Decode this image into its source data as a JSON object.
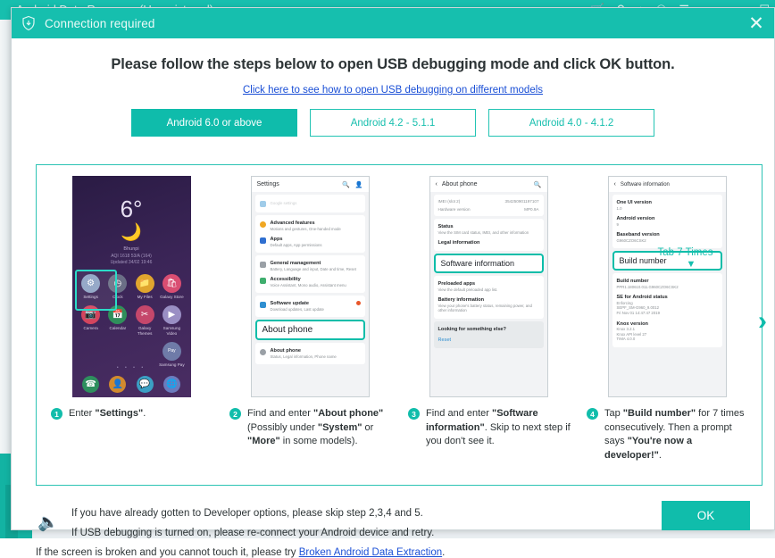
{
  "background_window": {
    "title": "Android Data Recovery (Unregistered)",
    "toolbar_icons": [
      "cart-icon",
      "key-icon",
      "download-icon",
      "chat-icon",
      "menu-icon"
    ],
    "window_controls": [
      "minimize-icon",
      "maximize-icon"
    ]
  },
  "dialog": {
    "title": "Connection required",
    "title_icon": "shield-download-icon",
    "close_label": "✕",
    "headline": "Please follow the steps below to open USB debugging mode and click OK button.",
    "sub_link": "Click here to see how to open USB debugging on different models",
    "next_arrow": "›",
    "tabs": [
      {
        "label": "Android 6.0 or above",
        "active": true
      },
      {
        "label": "Android 4.2 - 5.1.1",
        "active": false
      },
      {
        "label": "Android 4.0 - 4.1.2",
        "active": false
      }
    ]
  },
  "steps": [
    {
      "number": "1",
      "caption_parts": [
        {
          "text": "Enter ",
          "bold": false
        },
        {
          "text": "\"Settings\"",
          "bold": true
        },
        {
          "text": ".",
          "bold": false
        }
      ]
    },
    {
      "number": "2",
      "caption_parts": [
        {
          "text": "Find and enter ",
          "bold": false
        },
        {
          "text": "\"About phone\"",
          "bold": true
        },
        {
          "text": " (Possibly under ",
          "bold": false
        },
        {
          "text": "\"System\"",
          "bold": true
        },
        {
          "text": " or ",
          "bold": false
        },
        {
          "text": "\"More\"",
          "bold": true
        },
        {
          "text": " in some models).",
          "bold": false
        }
      ]
    },
    {
      "number": "3",
      "caption_parts": [
        {
          "text": "Find and enter ",
          "bold": false
        },
        {
          "text": "\"Software information\"",
          "bold": true
        },
        {
          "text": ". Skip to next step if you don't see it.",
          "bold": false
        }
      ]
    },
    {
      "number": "4",
      "caption_parts": [
        {
          "text": "Tap ",
          "bold": false
        },
        {
          "text": "\"Build number\"",
          "bold": true
        },
        {
          "text": " for 7 times consecutively. Then a prompt says ",
          "bold": false
        },
        {
          "text": "\"You're now a developer!\"",
          "bold": true
        },
        {
          "text": ".",
          "bold": false
        }
      ]
    }
  ],
  "phone_home": {
    "temperature": "6°",
    "weather_icon": "moon-cloud-icon",
    "city": "Bhunpi",
    "air_quality": "AQI 1618 53/A (164)",
    "updated": "Updated 34/02 19:46",
    "selected_app": "Settings",
    "apps_row1": [
      {
        "name": "Settings",
        "icon": "gear-icon",
        "color": "#8fa3c4"
      },
      {
        "name": "Clock",
        "icon": "clock-icon",
        "color": "#6b6f86"
      },
      {
        "name": "My Files",
        "icon": "folder-icon",
        "color": "#e0a52e"
      },
      {
        "name": "Galaxy Store",
        "icon": "bag-icon",
        "color": "#d94e72"
      }
    ],
    "apps_row2": [
      {
        "name": "Camera",
        "icon": "camera-icon",
        "color": "#d3455e"
      },
      {
        "name": "Calendar",
        "icon": "calendar-icon",
        "color": "#2f8f5b"
      },
      {
        "name": "Galaxy Themes",
        "icon": "brush-icon",
        "color": "#c5476b"
      },
      {
        "name": "Samsung Video",
        "icon": "play-icon",
        "color": "#9a8fc4"
      }
    ],
    "apps_row3": [
      {
        "name": "Samsung Pay",
        "icon": "pay-icon",
        "color": "#6f7ba8"
      }
    ],
    "dock": [
      {
        "name": "Phone",
        "icon": "phone-icon",
        "color": "#2e8f5e"
      },
      {
        "name": "Contacts",
        "icon": "person-icon",
        "color": "#d18a2e"
      },
      {
        "name": "Messages",
        "icon": "message-icon",
        "color": "#3b9fc4"
      },
      {
        "name": "Internet",
        "icon": "browser-icon",
        "color": "#6b7bbd"
      }
    ],
    "page_dots": "• • • •"
  },
  "phone_settings": {
    "header": "Settings",
    "header_icons": [
      "search-icon",
      "account-icon"
    ],
    "partial_top": {
      "title": "Google settings",
      "icon": "google-icon"
    },
    "rows": [
      {
        "title": "Advanced features",
        "subtitle": "Motions and gestures, One-handed mode",
        "icon_color": "#f0a722"
      },
      {
        "title": "Apps",
        "subtitle": "Default apps, App permissions",
        "icon_color": "#2f6fd0"
      },
      {
        "title": "General management",
        "subtitle": "Battery, Language and input, Date and time, Reset",
        "icon_color": "#9aa0a6"
      },
      {
        "title": "Accessibility",
        "subtitle": "Voice Assistant, Mono audio, Assistant menu",
        "icon_color": "#3fae6e"
      },
      {
        "title": "Software update",
        "subtitle": "Download updates, Last update",
        "icon_color": "#2f8fd0",
        "badge": "update-badge"
      }
    ],
    "highlight": "About phone",
    "bottom_row": {
      "title": "About phone",
      "subtitle": "Status, Legal information, Phone name"
    }
  },
  "phone_about": {
    "header": "About phone",
    "back_icon": "chevron-left-icon",
    "search_icon": "search-icon",
    "kv": [
      {
        "key": "IMEI (slot 2)",
        "value": "354250901197107"
      },
      {
        "key": "Hardware version",
        "value": "MP0.9A"
      }
    ],
    "rows": [
      {
        "title": "Status",
        "subtitle": "View the SIM card status, IMEI, and other information"
      },
      {
        "title": "Legal information",
        "subtitle": ""
      }
    ],
    "highlight": "Software information",
    "rows_after": [
      {
        "title": "Preloaded apps",
        "subtitle": "View the default preloaded app list."
      },
      {
        "title": "Battery information",
        "subtitle": "View your phone's battery status, remaining power, and other information"
      }
    ],
    "footer_title": "Looking for something else?",
    "footer_link": "Reset"
  },
  "phone_software": {
    "header": "Software information",
    "back_icon": "chevron-left-icon",
    "rows": [
      {
        "title": "One UI version",
        "subtitle": "1.0"
      },
      {
        "title": "Android version",
        "subtitle": "9"
      },
      {
        "title": "Baseband version",
        "subtitle": "G960CZO6CSK2"
      }
    ],
    "overlay_text": "Tab 7 Times",
    "overlay_arrow": "▼",
    "highlight": "Build number",
    "rows_after": [
      {
        "title": "Build number",
        "subtitle": "PPR1.180610.011.G960CZO6CSK2"
      },
      {
        "title": "SE for Android status",
        "subtitle": "Enforcing\nSEPF_SM-G960_9.0012\nFri Nov 01 14:47:47 2019"
      },
      {
        "title": "Knox version",
        "subtitle": "Knox 3.2.1\nKnox API level 27\nTIMA 4.0.0"
      }
    ]
  },
  "footer": {
    "speaker_icon": "speaker-icon",
    "line1": "If you have already gotten to Developer options, please skip step 2,3,4 and 5.",
    "line2": "If USB debugging is turned on, please re-connect your Android device and retry.",
    "line3_prefix": "If the screen is broken and you cannot touch it, please try ",
    "line3_link": "Broken Android Data Extraction",
    "line3_suffix": ".",
    "ok_label": "OK"
  },
  "colors": {
    "accent": "#10bdab",
    "link": "#1a4fd6",
    "highlight_border": "#0cbda9"
  }
}
